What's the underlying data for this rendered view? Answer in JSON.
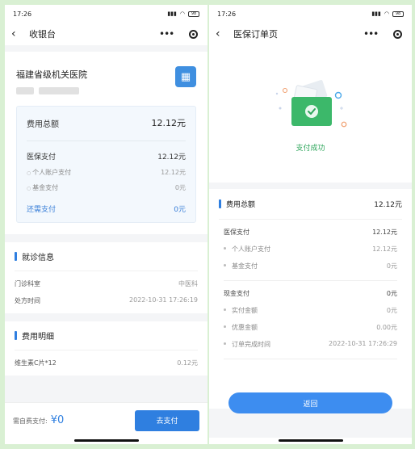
{
  "left": {
    "status": {
      "time": "17:26",
      "battery": "98"
    },
    "nav": {
      "title": "收银台"
    },
    "hospital": {
      "name": "福建省级机关医院"
    },
    "fees": {
      "total_label": "费用总额",
      "total_value": "12.12元",
      "insurance_label": "医保支付",
      "insurance_value": "12.12元",
      "personal_label": "个人账户支付",
      "personal_value": "12.12元",
      "fund_label": "基金支付",
      "fund_value": "0元",
      "need_label": "还需支付",
      "need_value": "0元"
    },
    "visit": {
      "title": "就诊信息",
      "dept_label": "门诊科室",
      "dept_value": "中医科",
      "rx_time_label": "处方时间",
      "rx_time_value": "2022-10-31 17:26:19"
    },
    "detail": {
      "title": "费用明细",
      "item_label": "维生素C片*12",
      "item_value": "0.12元"
    },
    "paybar": {
      "label": "需自费支付:",
      "amount": "¥0",
      "button": "去支付"
    }
  },
  "right": {
    "status": {
      "time": "17:26",
      "battery": "98"
    },
    "nav": {
      "title": "医保订单页"
    },
    "success_text": "支付成功",
    "summary": {
      "total_label": "费用总额",
      "total_value": "12.12元",
      "insurance_label": "医保支付",
      "insurance_value": "12.12元",
      "personal_label": "个人账户支付",
      "personal_value": "12.12元",
      "fund_label": "基金支付",
      "fund_value": "0元",
      "cash_label": "现金支付",
      "cash_value": "0元",
      "actual_label": "实付金额",
      "actual_value": "0元",
      "discount_label": "优惠金额",
      "discount_value": "0.00元",
      "done_label": "订单完成时间",
      "done_value": "2022-10-31 17:26:29"
    },
    "return_button": "返回"
  },
  "colors": {
    "accent": "#2f7fe0",
    "success": "#2ca55a",
    "background": "#d9f0d3"
  }
}
